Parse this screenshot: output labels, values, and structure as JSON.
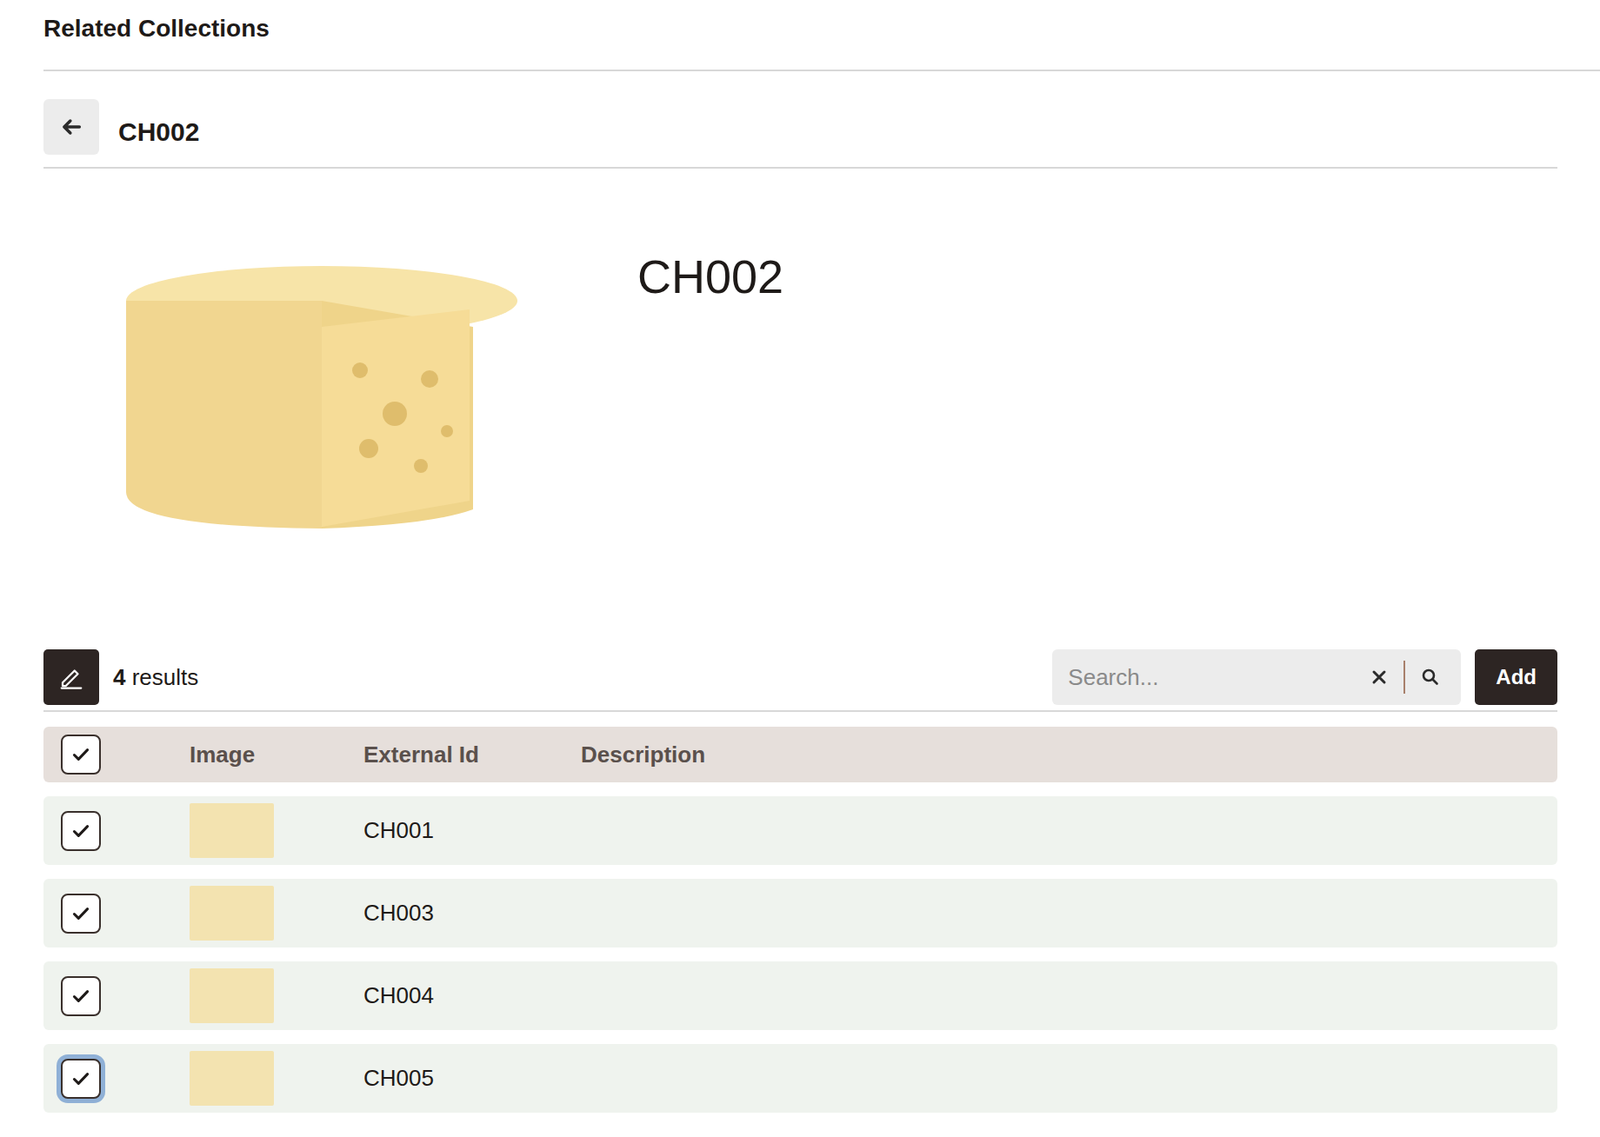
{
  "page": {
    "title": "Related Collections"
  },
  "breadcrumb": {
    "title": "CH002"
  },
  "item": {
    "title": "CH002"
  },
  "toolbar": {
    "count": "4",
    "count_label": "results",
    "search": {
      "placeholder": "Search...",
      "value": ""
    },
    "add_button": "Add"
  },
  "table": {
    "header_checked": true,
    "columns": [
      "Image",
      "External Id",
      "Description"
    ],
    "rows": [
      {
        "external_id": "CH001",
        "description": "",
        "checked": true,
        "focused": false
      },
      {
        "external_id": "CH003",
        "description": "",
        "checked": true,
        "focused": false
      },
      {
        "external_id": "CH004",
        "description": "",
        "checked": true,
        "focused": false
      },
      {
        "external_id": "CH005",
        "description": "",
        "checked": true,
        "focused": true
      }
    ]
  }
}
